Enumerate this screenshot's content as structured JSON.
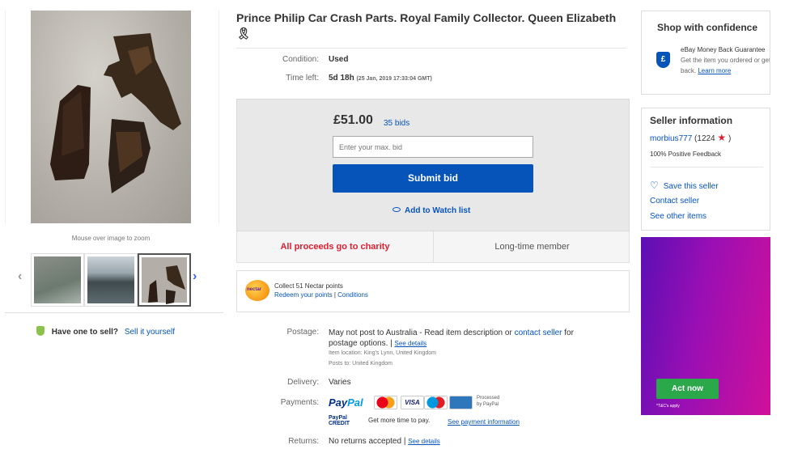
{
  "gallery": {
    "zoom_hint": "Mouse over image to zoom",
    "prev_icon": "‹",
    "next_icon": "›"
  },
  "sell": {
    "question": "Have one to sell?",
    "link": "Sell it yourself"
  },
  "listing": {
    "title": "Prince Philip Car Crash Parts. Royal Family Collector. Queen Elizabeth",
    "ribbon_icon": "🎗",
    "condition_label": "Condition:",
    "condition_value": "Used",
    "time_label": "Time left:",
    "time_value": "5d 18h",
    "time_detail": "(25 Jan, 2019   17:33:04 GMT)"
  },
  "bid": {
    "price": "£51.00",
    "bids": "35 bids",
    "input_placeholder": "Enter your max. bid",
    "submit_label": "Submit bid",
    "watch_label": "Add to Watch list",
    "charity": "All proceeds go to charity",
    "member": "Long-time member"
  },
  "nectar": {
    "logo": "nectar",
    "line1": "Collect 51 Nectar points",
    "redeem": "Redeem your points",
    "sep": " | ",
    "conditions": "Conditions"
  },
  "details": {
    "postage_label": "Postage:",
    "postage_text": "May not post to Australia - Read item description or",
    "contact_link": "contact seller",
    "postage_text2": "for",
    "postage_text3": "postage options.",
    "see_details": "See details",
    "item_location": "Item location:  King's Lynn, United Kingdom",
    "posts_to": "Posts to:  United Kingdom",
    "delivery_label": "Delivery:",
    "delivery_value": "Varies",
    "payments_label": "Payments:",
    "paypal_pay": "Pay",
    "paypal_pal": "Pal",
    "visa": "VISA",
    "processed": "Processed by PayPal",
    "pp_credit": "PayPal CREDIT",
    "credit_text": "Get more time to pay.",
    "see_payment": "See payment information",
    "returns_label": "Returns:",
    "returns_value": "No returns accepted",
    "returns_details": "See details"
  },
  "shop": {
    "title": "Shop with confidence",
    "shield": "£",
    "guarantee": "eBay Money Back Guarantee",
    "desc": "Get the item you ordered or get your money",
    "back": "back.",
    "learn": "Learn more"
  },
  "seller": {
    "heading": "Seller information",
    "name": "morbius777",
    "score": "(1224",
    "star": "★",
    "close": " )",
    "feedback": "100% Positive Feedback",
    "save": "Save this seller",
    "heart": "♡",
    "contact": "Contact seller",
    "other": "See other items"
  },
  "ad": {
    "button": "Act now",
    "tc": "*T&C's apply"
  }
}
